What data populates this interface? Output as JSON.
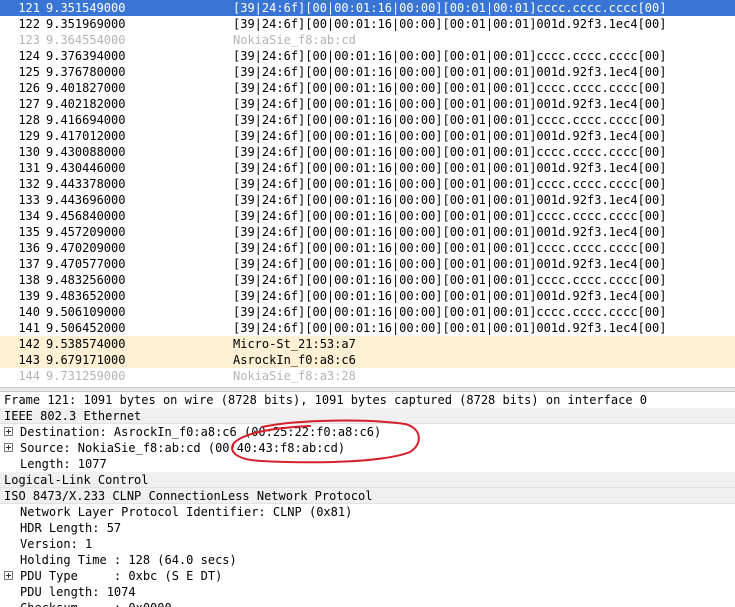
{
  "packet_list": {
    "rows": [
      {
        "no": "121",
        "time": "9.351549000",
        "info": "[39|24:6f][00|00:01:16|00:00][00:01|00:01]cccc.cccc.cccc[00]",
        "style": "selected"
      },
      {
        "no": "122",
        "time": "9.351969000",
        "info": "[39|24:6f][00|00:01:16|00:00][00:01|00:01]001d.92f3.1ec4[00]",
        "style": "normal"
      },
      {
        "no": "123",
        "time": "9.364554000",
        "info": "NokiaSie_f8:ab:cd",
        "style": "dim"
      },
      {
        "no": "124",
        "time": "9.376394000",
        "info": "[39|24:6f][00|00:01:16|00:00][00:01|00:01]cccc.cccc.cccc[00]",
        "style": "normal"
      },
      {
        "no": "125",
        "time": "9.376780000",
        "info": "[39|24:6f][00|00:01:16|00:00][00:01|00:01]001d.92f3.1ec4[00]",
        "style": "normal"
      },
      {
        "no": "126",
        "time": "9.401827000",
        "info": "[39|24:6f][00|00:01:16|00:00][00:01|00:01]cccc.cccc.cccc[00]",
        "style": "normal"
      },
      {
        "no": "127",
        "time": "9.402182000",
        "info": "[39|24:6f][00|00:01:16|00:00][00:01|00:01]001d.92f3.1ec4[00]",
        "style": "normal"
      },
      {
        "no": "128",
        "time": "9.416694000",
        "info": "[39|24:6f][00|00:01:16|00:00][00:01|00:01]cccc.cccc.cccc[00]",
        "style": "normal"
      },
      {
        "no": "129",
        "time": "9.417012000",
        "info": "[39|24:6f][00|00:01:16|00:00][00:01|00:01]001d.92f3.1ec4[00]",
        "style": "normal"
      },
      {
        "no": "130",
        "time": "9.430088000",
        "info": "[39|24:6f][00|00:01:16|00:00][00:01|00:01]cccc.cccc.cccc[00]",
        "style": "normal"
      },
      {
        "no": "131",
        "time": "9.430446000",
        "info": "[39|24:6f][00|00:01:16|00:00][00:01|00:01]001d.92f3.1ec4[00]",
        "style": "normal"
      },
      {
        "no": "132",
        "time": "9.443378000",
        "info": "[39|24:6f][00|00:01:16|00:00][00:01|00:01]cccc.cccc.cccc[00]",
        "style": "normal"
      },
      {
        "no": "133",
        "time": "9.443696000",
        "info": "[39|24:6f][00|00:01:16|00:00][00:01|00:01]001d.92f3.1ec4[00]",
        "style": "normal"
      },
      {
        "no": "134",
        "time": "9.456840000",
        "info": "[39|24:6f][00|00:01:16|00:00][00:01|00:01]cccc.cccc.cccc[00]",
        "style": "normal"
      },
      {
        "no": "135",
        "time": "9.457209000",
        "info": "[39|24:6f][00|00:01:16|00:00][00:01|00:01]001d.92f3.1ec4[00]",
        "style": "normal"
      },
      {
        "no": "136",
        "time": "9.470209000",
        "info": "[39|24:6f][00|00:01:16|00:00][00:01|00:01]cccc.cccc.cccc[00]",
        "style": "normal"
      },
      {
        "no": "137",
        "time": "9.470577000",
        "info": "[39|24:6f][00|00:01:16|00:00][00:01|00:01]001d.92f3.1ec4[00]",
        "style": "normal"
      },
      {
        "no": "138",
        "time": "9.483256000",
        "info": "[39|24:6f][00|00:01:16|00:00][00:01|00:01]cccc.cccc.cccc[00]",
        "style": "normal"
      },
      {
        "no": "139",
        "time": "9.483652000",
        "info": "[39|24:6f][00|00:01:16|00:00][00:01|00:01]001d.92f3.1ec4[00]",
        "style": "normal"
      },
      {
        "no": "140",
        "time": "9.506109000",
        "info": "[39|24:6f][00|00:01:16|00:00][00:01|00:01]cccc.cccc.cccc[00]",
        "style": "normal"
      },
      {
        "no": "141",
        "time": "9.506452000",
        "info": "[39|24:6f][00|00:01:16|00:00][00:01|00:01]001d.92f3.1ec4[00]",
        "style": "normal"
      },
      {
        "no": "142",
        "time": "9.538574000",
        "info": "Micro-St_21:53:a7",
        "style": "proto"
      },
      {
        "no": "143",
        "time": "9.679171000",
        "info": "AsrockIn_f0:a8:c6",
        "style": "proto"
      },
      {
        "no": "144",
        "time": "9.731259000",
        "info": "NokiaSie_f8:a3:28",
        "style": "dim"
      }
    ]
  },
  "details": {
    "rows": [
      {
        "text": "Frame 121: 1091 bytes on wire (8728 bits), 1091 bytes captured (8728 bits) on interface 0",
        "indent": 0,
        "expander": false,
        "header": false
      },
      {
        "text": "IEEE 802.3 Ethernet",
        "indent": 0,
        "expander": false,
        "header": true
      },
      {
        "text": "Destination: AsrockIn_f0:a8:c6 (00:25:22:f0:a8:c6)",
        "indent": 1,
        "expander": true,
        "header": false
      },
      {
        "text": "Source: NokiaSie_f8:ab:cd (00:40:43:f8:ab:cd)",
        "indent": 1,
        "expander": true,
        "header": false
      },
      {
        "text": "Length: 1077",
        "indent": 1,
        "expander": false,
        "header": false
      },
      {
        "text": "Logical-Link Control",
        "indent": 0,
        "expander": false,
        "header": true
      },
      {
        "text": "ISO 8473/X.233 CLNP ConnectionLess Network Protocol",
        "indent": 0,
        "expander": false,
        "header": true
      },
      {
        "text": "Network Layer Protocol Identifier: CLNP (0x81)",
        "indent": 1,
        "expander": false,
        "header": false
      },
      {
        "text": "HDR Length: 57",
        "indent": 1,
        "expander": false,
        "header": false
      },
      {
        "text": "Version: 1",
        "indent": 1,
        "expander": false,
        "header": false
      },
      {
        "text": "Holding Time : 128 (64.0 secs)",
        "indent": 1,
        "expander": false,
        "header": false
      },
      {
        "text": "PDU Type     : 0xbc (S E DT)",
        "indent": 1,
        "expander": true,
        "header": false
      },
      {
        "text": "PDU length: 1074",
        "indent": 1,
        "expander": false,
        "header": false
      },
      {
        "text": "Checksum     : 0x0000",
        "indent": 1,
        "expander": false,
        "header": false
      }
    ]
  },
  "annotation": {
    "color": "#d4202a"
  }
}
